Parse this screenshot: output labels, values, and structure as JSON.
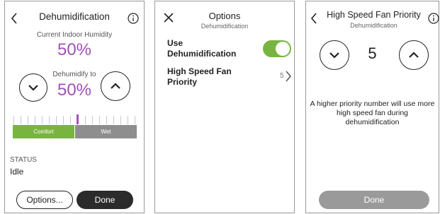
{
  "dehumidification_screen": {
    "title": "Dehumidification",
    "current_label": "Current Indoor Humidity",
    "current_value": "50%",
    "setpoint_label": "Dehumidify to",
    "setpoint_value": "50%",
    "range": {
      "comfort_label": "Comfort",
      "wet_label": "Wet",
      "tick_count": 18,
      "active_index": 9
    },
    "status_label": "STATUS",
    "status_value": "Idle",
    "options_button": "Options...",
    "done_button": "Done",
    "icons": {
      "back": "chevron-left-icon",
      "info": "info-icon",
      "down": "chevron-down-icon",
      "up": "chevron-up-icon"
    }
  },
  "options_screen": {
    "title": "Options",
    "subtitle": "Dehumidification",
    "use_dehum_label": "Use Dehumidification",
    "use_dehum_enabled": true,
    "fan_priority_label": "High Speed Fan Priority",
    "fan_priority_value": "5",
    "icons": {
      "close": "close-icon",
      "next": "chevron-right-icon"
    }
  },
  "fan_priority_screen": {
    "title": "High Speed Fan Priority",
    "subtitle": "Dehumidification",
    "value": "5",
    "info": "A higher priority number will use more high speed fan during dehumidification",
    "done_button": "Done",
    "icons": {
      "back": "chevron-left-icon",
      "info": "info-icon",
      "down": "chevron-down-icon",
      "up": "chevron-up-icon"
    }
  },
  "colors": {
    "humidity_purple": "#a150b8",
    "comfort_green": "#7ab440",
    "wet_gray": "#8e8e8e",
    "done_dark": "#2b2b2b",
    "done_disabled": "#9a9a9a"
  }
}
